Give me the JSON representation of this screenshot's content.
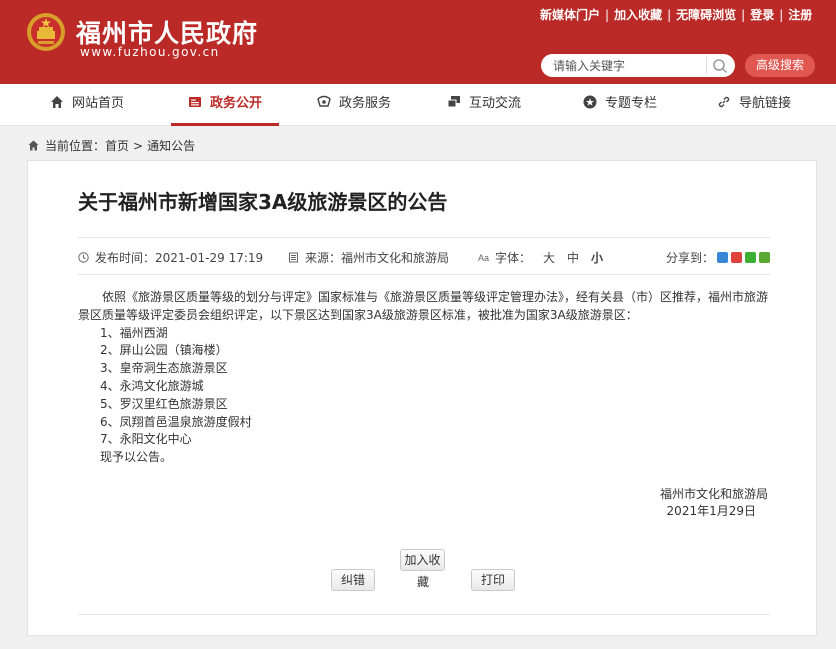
{
  "header": {
    "site_name": "福州市人民政府",
    "site_domain": "www.fuzhou.gov.cn",
    "toplinks": [
      "新媒体门户",
      "加入收藏",
      "无障碍浏览",
      "登录",
      "注册"
    ],
    "search_placeholder": "请输入关键字",
    "advanced_search": "高级搜索",
    "brand_color": "#bb2a27"
  },
  "nav": [
    {
      "label": "网站首页",
      "icon": "home-icon"
    },
    {
      "label": "政务公开",
      "icon": "document-icon",
      "active": true
    },
    {
      "label": "政务服务",
      "icon": "service-icon"
    },
    {
      "label": "互动交流",
      "icon": "chat-icon"
    },
    {
      "label": "专题专栏",
      "icon": "star-icon"
    },
    {
      "label": "导航链接",
      "icon": "link-icon"
    }
  ],
  "breadcrumb": {
    "prefix": "当前位置：",
    "items": [
      "首页",
      "通知公告"
    ],
    "sep": ">"
  },
  "article": {
    "title": "关于福州市新增国家3A级旅游景区的公告",
    "publish_label": "发布时间：",
    "publish_time": "2021-01-29 17:19",
    "source_label": "来源：",
    "source": "福州市文化和旅游局",
    "font_label": "字体：",
    "font_sizes": [
      "大",
      "中",
      "小"
    ],
    "share_label": "分享到：",
    "intro": "依照《旅游景区质量等级的划分与评定》国家标准与《旅游景区质量等级评定管理办法》，经有关县（市）区推荐，福州市旅游景区质量等级评定委员会组织评定，以下景区达到国家3A级旅游景区标准，被批准为国家3A级旅游景区：",
    "items": [
      "1、福州西湖",
      "2、屏山公园（镇海楼）",
      "3、皇帝洞生态旅游景区",
      "4、永鸿文化旅游城",
      "5、罗汉里红色旅游景区",
      "6、凤翔首邑温泉旅游度假村",
      "7、永阳文化中心"
    ],
    "closing": "现予以公告。",
    "signature": "福州市文化和旅游局",
    "date": "2021年1月29日"
  },
  "actions": {
    "correct": "纠错",
    "favorite": "加入收",
    "favorite_tail": "藏",
    "print": "打印"
  }
}
